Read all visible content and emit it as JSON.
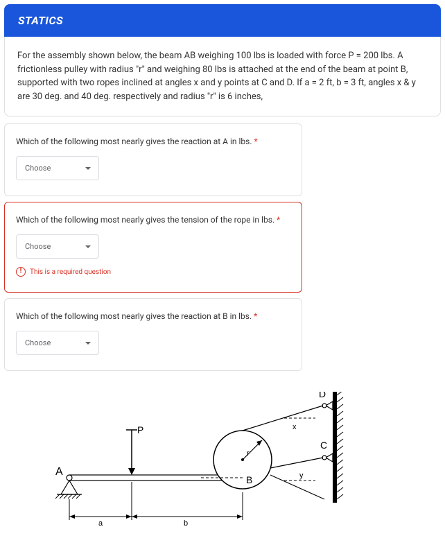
{
  "header": {
    "title": "STATICS"
  },
  "description": "For the assembly shown below, the beam AB weighing 100 lbs is loaded with force P = 200 lbs. A frictionless pulley with radius \"r\" and weighing 80 lbs is attached at the end of the beam at point B, supported  with two ropes inclined at angles x and y points at C and D. If a = 2 ft, b = 3 ft, angles x & y are 30 deg. and 40 deg. respectively and radius \"r\" is 6 inches,",
  "questions": [
    {
      "text": "Which of the following most nearly gives the reaction at A in lbs.",
      "required": "*",
      "selected": "Choose"
    },
    {
      "text": "Which of the following most nearly gives the tension of the rope in lbs.",
      "required": "*",
      "selected": "Choose",
      "error": "This is a required question"
    },
    {
      "text": "Which of the following most nearly gives the reaction at B in lbs.",
      "required": "*",
      "selected": "Choose"
    }
  ],
  "diagram": {
    "labels": {
      "A": "A",
      "B": "B",
      "C": "C",
      "D": "D",
      "P": "P",
      "a": "a",
      "b": "b",
      "r": "r",
      "x": "x",
      "y": "y"
    }
  }
}
